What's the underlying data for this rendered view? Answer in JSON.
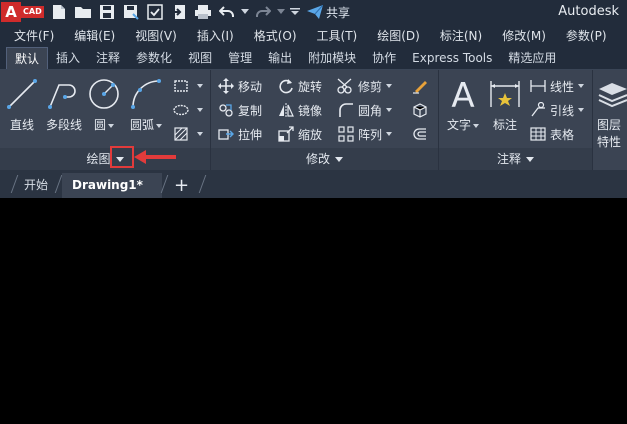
{
  "app": {
    "logo_letter": "A",
    "logo_tag": "CAD",
    "share_label": "共享",
    "brand": "Autodesk"
  },
  "menu": [
    "文件(F)",
    "编辑(E)",
    "视图(V)",
    "插入(I)",
    "格式(O)",
    "工具(T)",
    "绘图(D)",
    "标注(N)",
    "修改(M)",
    "参数(P)"
  ],
  "ribbon_tabs": [
    "默认",
    "插入",
    "注释",
    "参数化",
    "视图",
    "管理",
    "输出",
    "附加模块",
    "协作",
    "Express Tools",
    "精选应用"
  ],
  "active_tab": "默认",
  "draw_panel": {
    "title": "绘图",
    "buttons": [
      "直线",
      "多段线",
      "圆",
      "圆弧"
    ]
  },
  "modify_panel": {
    "title": "修改",
    "items": [
      "移动",
      "旋转",
      "修剪",
      "复制",
      "镜像",
      "圆角",
      "拉伸",
      "缩放",
      "阵列"
    ]
  },
  "annotation_panel": {
    "title": "注释",
    "text_label": "文字",
    "dim_label": "标注",
    "items": [
      "线性",
      "引线",
      "表格"
    ]
  },
  "layers_panel": {
    "label_line1": "图层",
    "label_line2": "特性"
  },
  "file_tabs": {
    "start": "开始",
    "drawing": "Drawing1*",
    "close": "×",
    "add": "+"
  },
  "colors": {
    "background": "#000000",
    "ribbon": "#3b4453",
    "titlebar": "#222c3b",
    "highlight": "#e23b3b",
    "accent_blue": "#5aa7e8"
  }
}
